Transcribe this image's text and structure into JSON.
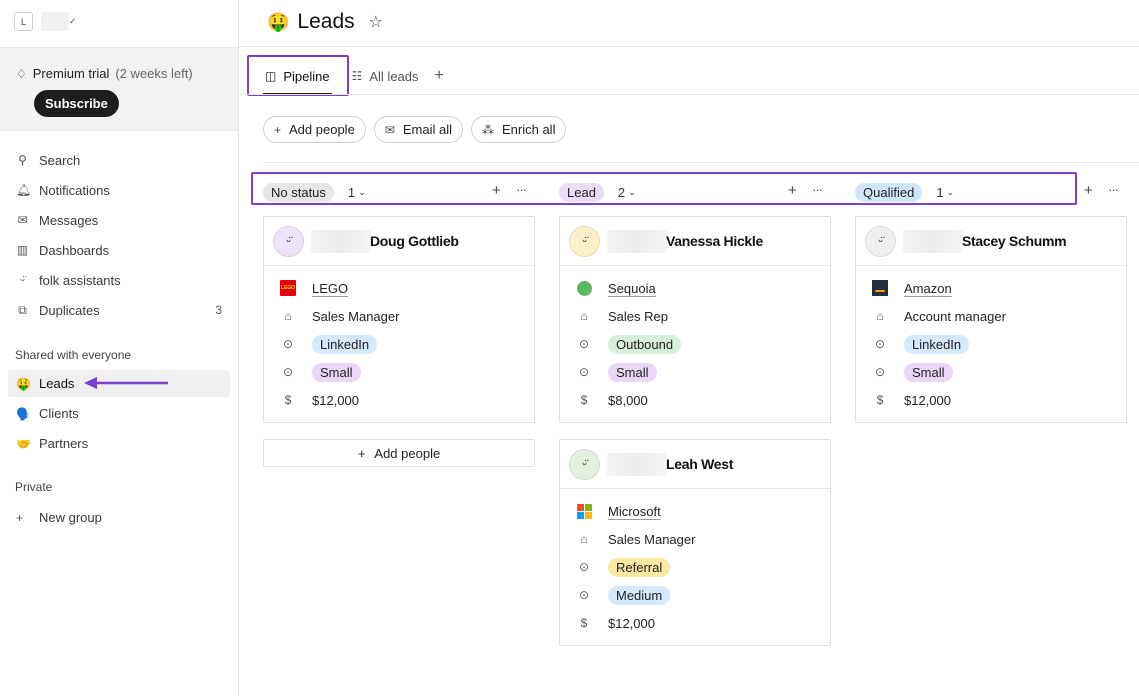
{
  "sidebar": {
    "workspace_initial": "L",
    "trial": {
      "label": "Premium trial",
      "remaining": "(2 weeks left)",
      "subscribe": "Subscribe"
    },
    "nav": [
      {
        "label": "Search",
        "icon": "search-icon"
      },
      {
        "label": "Notifications",
        "icon": "bell-icon"
      },
      {
        "label": "Messages",
        "icon": "mail-icon"
      },
      {
        "label": "Dashboards",
        "icon": "chart-icon"
      },
      {
        "label": "folk assistants",
        "icon": "assistant-icon"
      },
      {
        "label": "Duplicates",
        "icon": "duplicate-icon",
        "count": "3"
      }
    ],
    "shared_label": "Shared with everyone",
    "groups": [
      {
        "label": "Leads",
        "emoji": "🤑",
        "active": true
      },
      {
        "label": "Clients",
        "emoji": "🗣️"
      },
      {
        "label": "Partners",
        "emoji": "🤝"
      }
    ],
    "private_label": "Private",
    "new_group": "New group"
  },
  "header": {
    "emoji": "🤑",
    "title": "Leads"
  },
  "tabs": [
    {
      "label": "Pipeline",
      "active": true
    },
    {
      "label": "All leads"
    }
  ],
  "actions": {
    "add_people": "Add people",
    "email_all": "Email all",
    "enrich_all": "Enrich all"
  },
  "columns": [
    {
      "status": "No status",
      "count": "1",
      "color": "#e6e6e6"
    },
    {
      "status": "Lead",
      "count": "2",
      "color": "#ecdcf7"
    },
    {
      "status": "Qualified",
      "count": "1",
      "color": "#cfe6fb"
    }
  ],
  "cards": [
    {
      "name": "Doug Gottlieb",
      "avatar_bg": "#efe3f9",
      "company": "LEGO",
      "role": "Sales Manager",
      "source": "LinkedIn",
      "source_color": "#d4e9fb",
      "size": "Small",
      "size_color": "#ead6f6",
      "value": "$12,000"
    },
    {
      "name": "Vanessa Hickle",
      "avatar_bg": "#fbf0c8",
      "company": "Sequoia",
      "role": "Sales Rep",
      "source": "Outbound",
      "source_color": "#d6efdb",
      "size": "Small",
      "size_color": "#ead6f6",
      "value": "$8,000"
    },
    {
      "name": "Stacey Schumm",
      "avatar_bg": "#efefef",
      "company": "Amazon",
      "role": "Account manager",
      "source": "LinkedIn",
      "source_color": "#d4e9fb",
      "size": "Small",
      "size_color": "#ead6f6",
      "value": "$12,000"
    },
    {
      "name": "Leah West",
      "avatar_bg": "#e3f1de",
      "company": "Microsoft",
      "role": "Sales Manager",
      "source": "Referral",
      "source_color": "#fbe8a2",
      "size": "Medium",
      "size_color": "#d4e9fb",
      "value": "$12,000"
    }
  ],
  "add_people_column": "Add people"
}
